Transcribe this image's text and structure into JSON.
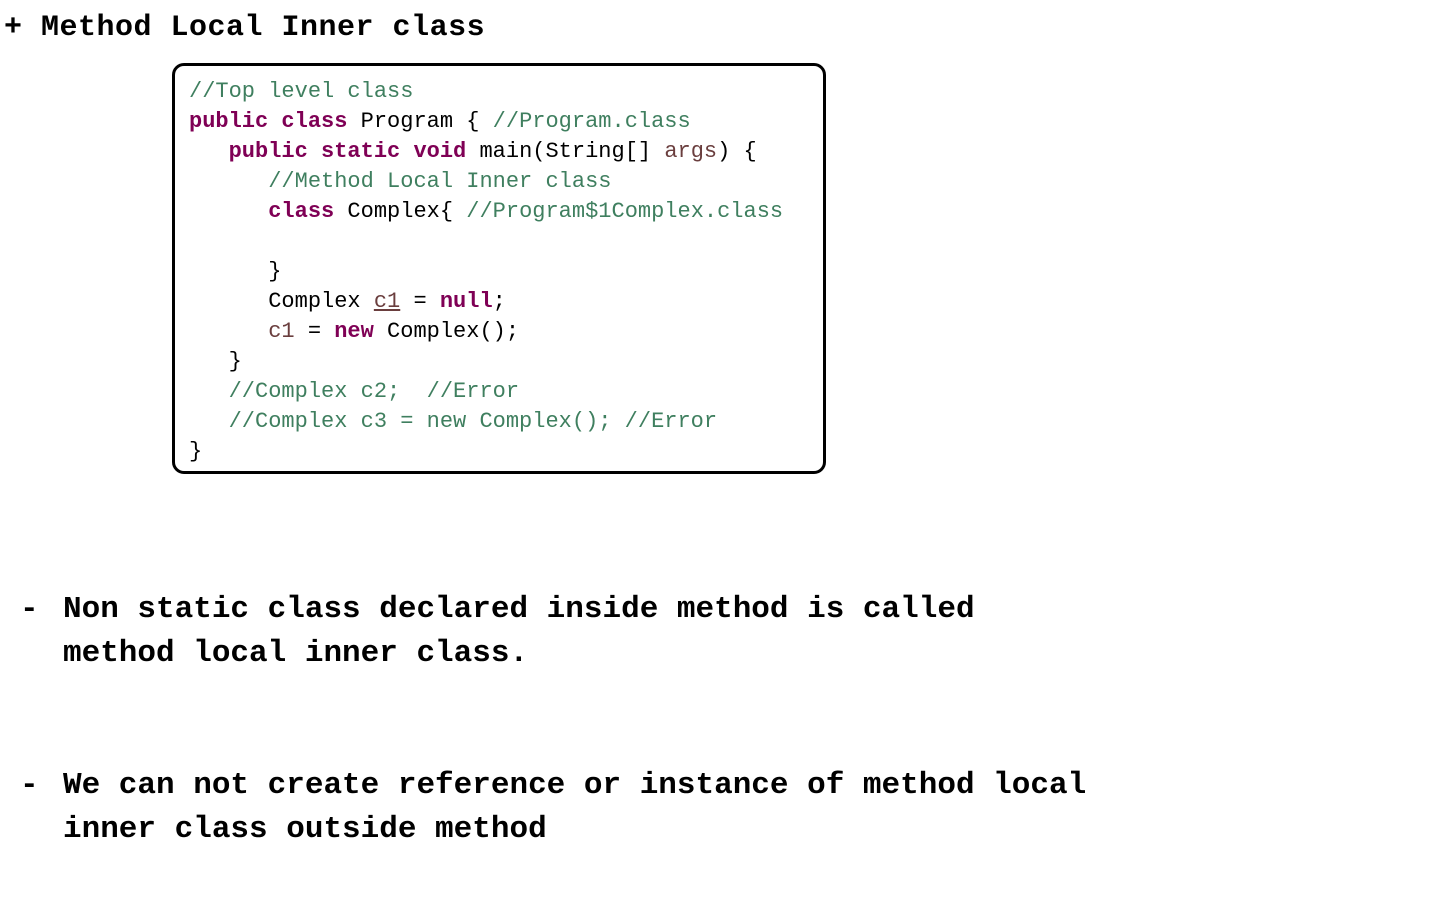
{
  "heading": "+ Method Local Inner class",
  "code": {
    "lines": [
      {
        "indent": 0,
        "tokens": [
          {
            "t": "//Top level class",
            "c": "cm"
          }
        ]
      },
      {
        "indent": 0,
        "tokens": [
          {
            "t": "public",
            "c": "kw"
          },
          {
            "t": " ",
            "c": "pl"
          },
          {
            "t": "class",
            "c": "kw"
          },
          {
            "t": " Program { ",
            "c": "pl"
          },
          {
            "t": "//Program.class",
            "c": "cm"
          }
        ]
      },
      {
        "indent": 1,
        "tokens": [
          {
            "t": "public",
            "c": "kw"
          },
          {
            "t": " ",
            "c": "pl"
          },
          {
            "t": "static",
            "c": "kw"
          },
          {
            "t": " ",
            "c": "pl"
          },
          {
            "t": "void",
            "c": "kw"
          },
          {
            "t": " main(String[] ",
            "c": "pl"
          },
          {
            "t": "args",
            "c": "var"
          },
          {
            "t": ") {",
            "c": "pl"
          }
        ]
      },
      {
        "indent": 2,
        "tokens": [
          {
            "t": "//Method Local Inner class",
            "c": "cm"
          }
        ]
      },
      {
        "indent": 2,
        "tokens": [
          {
            "t": "class",
            "c": "kw"
          },
          {
            "t": " Complex{ ",
            "c": "pl"
          },
          {
            "t": "//Program$1Complex.class",
            "c": "cm"
          }
        ]
      },
      {
        "indent": 2,
        "tokens": []
      },
      {
        "indent": 2,
        "tokens": [
          {
            "t": "}",
            "c": "pl"
          }
        ]
      },
      {
        "indent": 2,
        "tokens": [
          {
            "t": "Complex ",
            "c": "pl"
          },
          {
            "t": "c1",
            "c": "var-ul"
          },
          {
            "t": " = ",
            "c": "pl"
          },
          {
            "t": "null",
            "c": "kw"
          },
          {
            "t": ";",
            "c": "pl"
          }
        ]
      },
      {
        "indent": 2,
        "tokens": [
          {
            "t": "c1",
            "c": "var"
          },
          {
            "t": " = ",
            "c": "pl"
          },
          {
            "t": "new",
            "c": "kw"
          },
          {
            "t": " Complex();",
            "c": "pl"
          }
        ]
      },
      {
        "indent": 1,
        "tokens": [
          {
            "t": "}",
            "c": "pl"
          }
        ]
      },
      {
        "indent": 1,
        "tokens": [
          {
            "t": "//Complex c2;  //Error",
            "c": "cm"
          }
        ]
      },
      {
        "indent": 1,
        "tokens": [
          {
            "t": "//Complex c3 = new Complex(); //Error",
            "c": "cm"
          }
        ]
      },
      {
        "indent": 0,
        "tokens": [
          {
            "t": "}",
            "c": "pl"
          }
        ]
      }
    ]
  },
  "notes": [
    {
      "dash": "-",
      "text": "Non static class declared inside method is called\nmethod local inner class."
    },
    {
      "dash": "-",
      "text": "We can not create reference or instance of method local\ninner class outside method"
    }
  ],
  "colors": {
    "keyword": "#7f0055",
    "comment": "#3f7f5f",
    "variable": "#6a3e3e",
    "text": "#000000",
    "border": "#000000",
    "background": "#ffffff"
  }
}
